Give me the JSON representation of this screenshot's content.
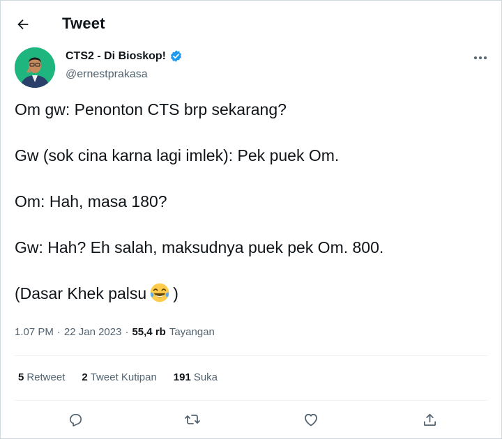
{
  "header": {
    "title": "Tweet"
  },
  "author": {
    "display_name": "CTS2 - Di Bioskop!",
    "handle": "@ernestprakasa",
    "verified": true
  },
  "tweet": {
    "lines": [
      "Om gw: Penonton CTS brp sekarang?",
      "Gw (sok cina karna lagi imlek): Pek puek Om.",
      "Om: Hah, masa 180?",
      "Gw: Hah? Eh salah, maksudnya puek pek Om. 800.",
      "(Dasar Khek palsu",
      ")"
    ],
    "emoji": "face-with-tears-of-joy"
  },
  "meta": {
    "time": "1.07 PM",
    "sep1": "·",
    "date": "22 Jan 2023",
    "sep2": "·",
    "views": "55,4 rb",
    "views_label": "Tayangan"
  },
  "stats": {
    "retweets_count": "5",
    "retweets_label": "Retweet",
    "quotes_count": "2",
    "quotes_label": "Tweet Kutipan",
    "likes_count": "191",
    "likes_label": "Suka"
  },
  "colors": {
    "text": "#0f1419",
    "secondary": "#536471",
    "verified": "#1d9bf0",
    "divider": "#eff3f4"
  },
  "icons": [
    "back-arrow-icon",
    "verified-badge-icon",
    "more-icon",
    "reply-icon",
    "retweet-icon",
    "like-icon",
    "share-icon"
  ]
}
